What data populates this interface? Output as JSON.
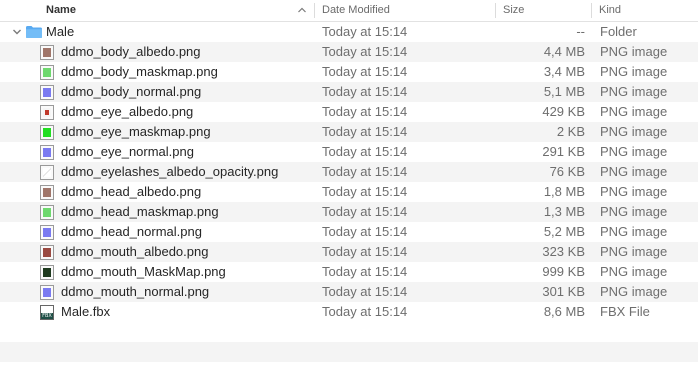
{
  "columns": {
    "name": "Name",
    "date": "Date Modified",
    "size": "Size",
    "kind": "Kind"
  },
  "folder": {
    "name": "Male",
    "date": "Today at 15:14",
    "size": "--",
    "kind": "Folder"
  },
  "files": [
    {
      "name": "ddmo_body_albedo.png",
      "date": "Today at 15:14",
      "size": "4,4 MB",
      "kind": "PNG image",
      "icon": "albedo-thumb-icon",
      "color": "#a0766a"
    },
    {
      "name": "ddmo_body_maskmap.png",
      "date": "Today at 15:14",
      "size": "3,4 MB",
      "kind": "PNG image",
      "icon": "maskmap-thumb-icon",
      "color": "#6ed86e"
    },
    {
      "name": "ddmo_body_normal.png",
      "date": "Today at 15:14",
      "size": "5,1 MB",
      "kind": "PNG image",
      "icon": "normal-thumb-icon",
      "color": "#7a7af0"
    },
    {
      "name": "ddmo_eye_albedo.png",
      "date": "Today at 15:14",
      "size": "429 KB",
      "kind": "PNG image",
      "icon": "eye-albedo-thumb-icon",
      "color": "#c0392b"
    },
    {
      "name": "ddmo_eye_maskmap.png",
      "date": "Today at 15:14",
      "size": "2 KB",
      "kind": "PNG image",
      "icon": "maskmap-thumb-icon",
      "color": "#22dd22"
    },
    {
      "name": "ddmo_eye_normal.png",
      "date": "Today at 15:14",
      "size": "291 KB",
      "kind": "PNG image",
      "icon": "normal-thumb-icon",
      "color": "#7a7af0"
    },
    {
      "name": "ddmo_eyelashes_albedo_opacity.png",
      "date": "Today at 15:14",
      "size": "76 KB",
      "kind": "PNG image",
      "icon": "opacity-thumb-icon",
      "color": "#e8e8e8"
    },
    {
      "name": "ddmo_head_albedo.png",
      "date": "Today at 15:14",
      "size": "1,8 MB",
      "kind": "PNG image",
      "icon": "albedo-thumb-icon",
      "color": "#a0766a"
    },
    {
      "name": "ddmo_head_maskmap.png",
      "date": "Today at 15:14",
      "size": "1,3 MB",
      "kind": "PNG image",
      "icon": "maskmap-thumb-icon",
      "color": "#6ed86e"
    },
    {
      "name": "ddmo_head_normal.png",
      "date": "Today at 15:14",
      "size": "5,2 MB",
      "kind": "PNG image",
      "icon": "normal-thumb-icon",
      "color": "#7a7af0"
    },
    {
      "name": "ddmo_mouth_albedo.png",
      "date": "Today at 15:14",
      "size": "323 KB",
      "kind": "PNG image",
      "icon": "albedo-thumb-icon",
      "color": "#9a4a42"
    },
    {
      "name": "ddmo_mouth_MaskMap.png",
      "date": "Today at 15:14",
      "size": "999 KB",
      "kind": "PNG image",
      "icon": "maskmap-thumb-icon",
      "color": "#1e3a1e"
    },
    {
      "name": "ddmo_mouth_normal.png",
      "date": "Today at 15:14",
      "size": "301 KB",
      "kind": "PNG image",
      "icon": "normal-thumb-icon",
      "color": "#7a7af0"
    },
    {
      "name": "Male.fbx",
      "date": "Today at 15:14",
      "size": "8,6 MB",
      "kind": "FBX File",
      "icon": "fbx-file-icon",
      "badge": "FBX",
      "color": "#1f4f46"
    }
  ]
}
